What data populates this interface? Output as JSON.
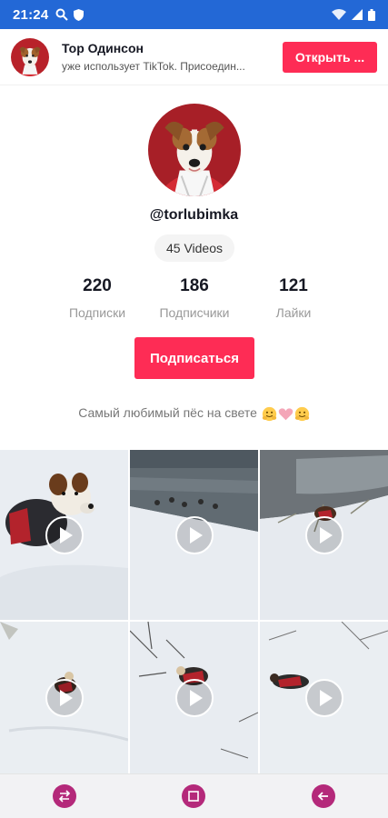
{
  "status_bar": {
    "time": "21:24",
    "left_icons": [
      "search-icon",
      "shield-icon"
    ],
    "right_icons": [
      "wifi-icon",
      "signal-icon",
      "battery-icon"
    ],
    "color": "#2368d6"
  },
  "banner": {
    "name": "Тор Одинсон",
    "subtitle": "уже использует TikTok. Присоедин...",
    "open_label": "Открыть ..."
  },
  "profile": {
    "username": "@torlubimka",
    "videos_count": "45 Videos",
    "stats": [
      {
        "value": "220",
        "label": "Подписки"
      },
      {
        "value": "186",
        "label": "Подписчики"
      },
      {
        "value": "121",
        "label": "Лайки"
      }
    ],
    "follow_label": "Подписаться",
    "bio": "Самый любимый пёс на свете",
    "bio_emojis": [
      "hugging-face-emoji",
      "pink-heart-emoji",
      "hugging-face-emoji"
    ]
  },
  "videos": [
    {
      "scene": "dog-closeup-snow",
      "icon": "play-icon"
    },
    {
      "scene": "river-ducks-snow",
      "icon": "play-icon"
    },
    {
      "scene": "river-dog-snow",
      "icon": "play-icon"
    },
    {
      "scene": "dog-running-snow",
      "icon": "play-icon"
    },
    {
      "scene": "dog-in-snow-branches",
      "icon": "play-icon"
    },
    {
      "scene": "dog-lying-snow",
      "icon": "play-icon"
    }
  ],
  "navbar": {
    "buttons": [
      "recent-apps-icon",
      "home-icon",
      "back-icon"
    ]
  },
  "colors": {
    "accent": "#fe2c55",
    "nav_button": "#b4297a",
    "secondary_text": "#999999"
  }
}
